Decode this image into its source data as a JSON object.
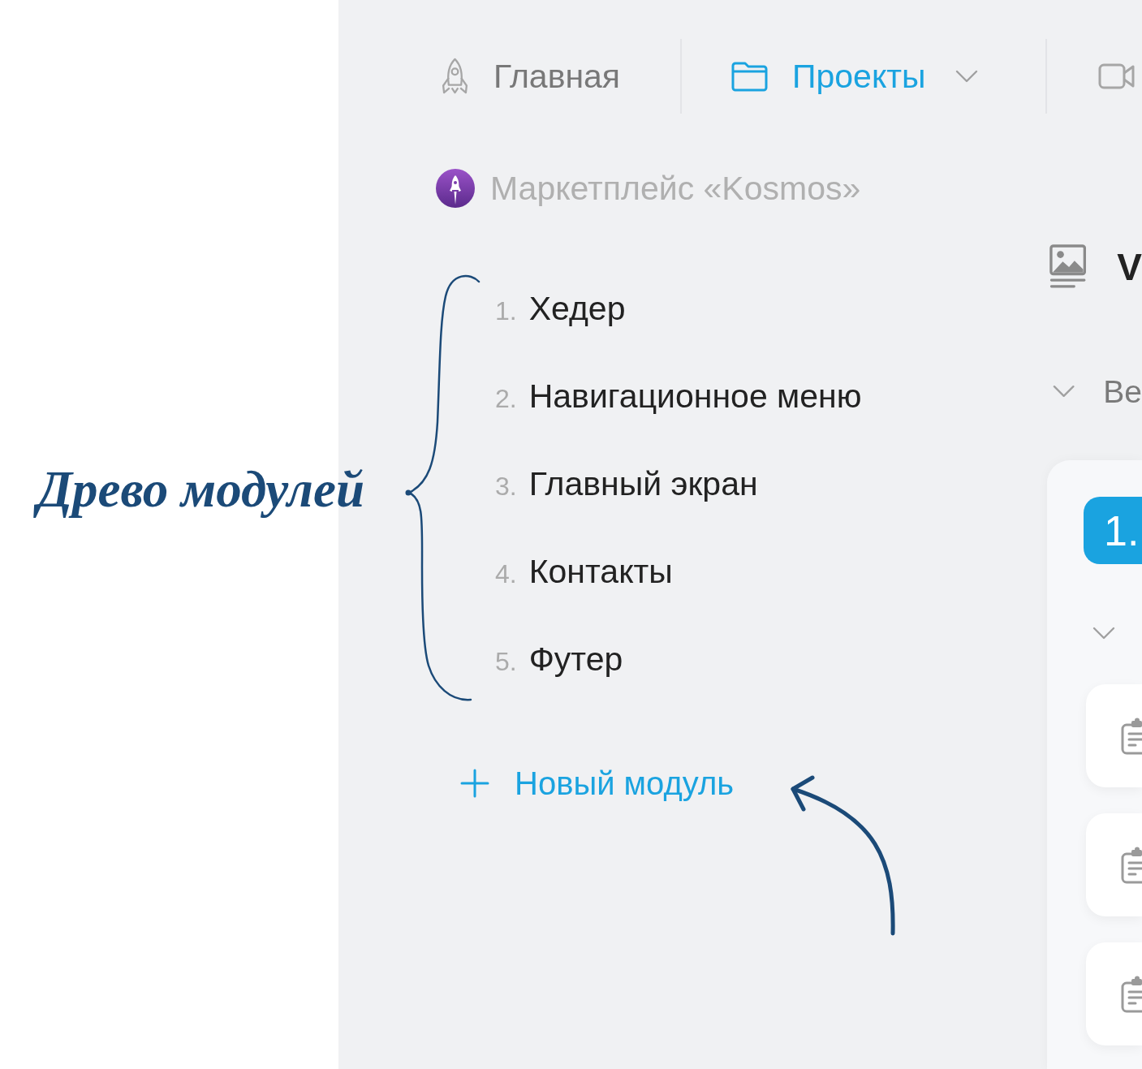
{
  "annotation": {
    "label": "Древо модулей"
  },
  "nav": {
    "tabs": [
      {
        "label": "Главная",
        "selected": false,
        "has_menu": false
      },
      {
        "label": "Проекты",
        "selected": true,
        "has_menu": true
      },
      {
        "selected": false,
        "has_menu": false
      }
    ]
  },
  "project": {
    "title": "Маркетплейс «Kosmos»"
  },
  "modules": {
    "items": [
      {
        "number": "1.",
        "label": "Хедер"
      },
      {
        "number": "2.",
        "label": "Навигационное меню"
      },
      {
        "number": "3.",
        "label": "Главный экран"
      },
      {
        "number": "4.",
        "label": "Контакты"
      },
      {
        "number": "5.",
        "label": "Футер"
      }
    ],
    "add_label": "Новый модуль"
  },
  "detail": {
    "heading": "V",
    "section_label": "Ве",
    "version_badge": "1."
  }
}
